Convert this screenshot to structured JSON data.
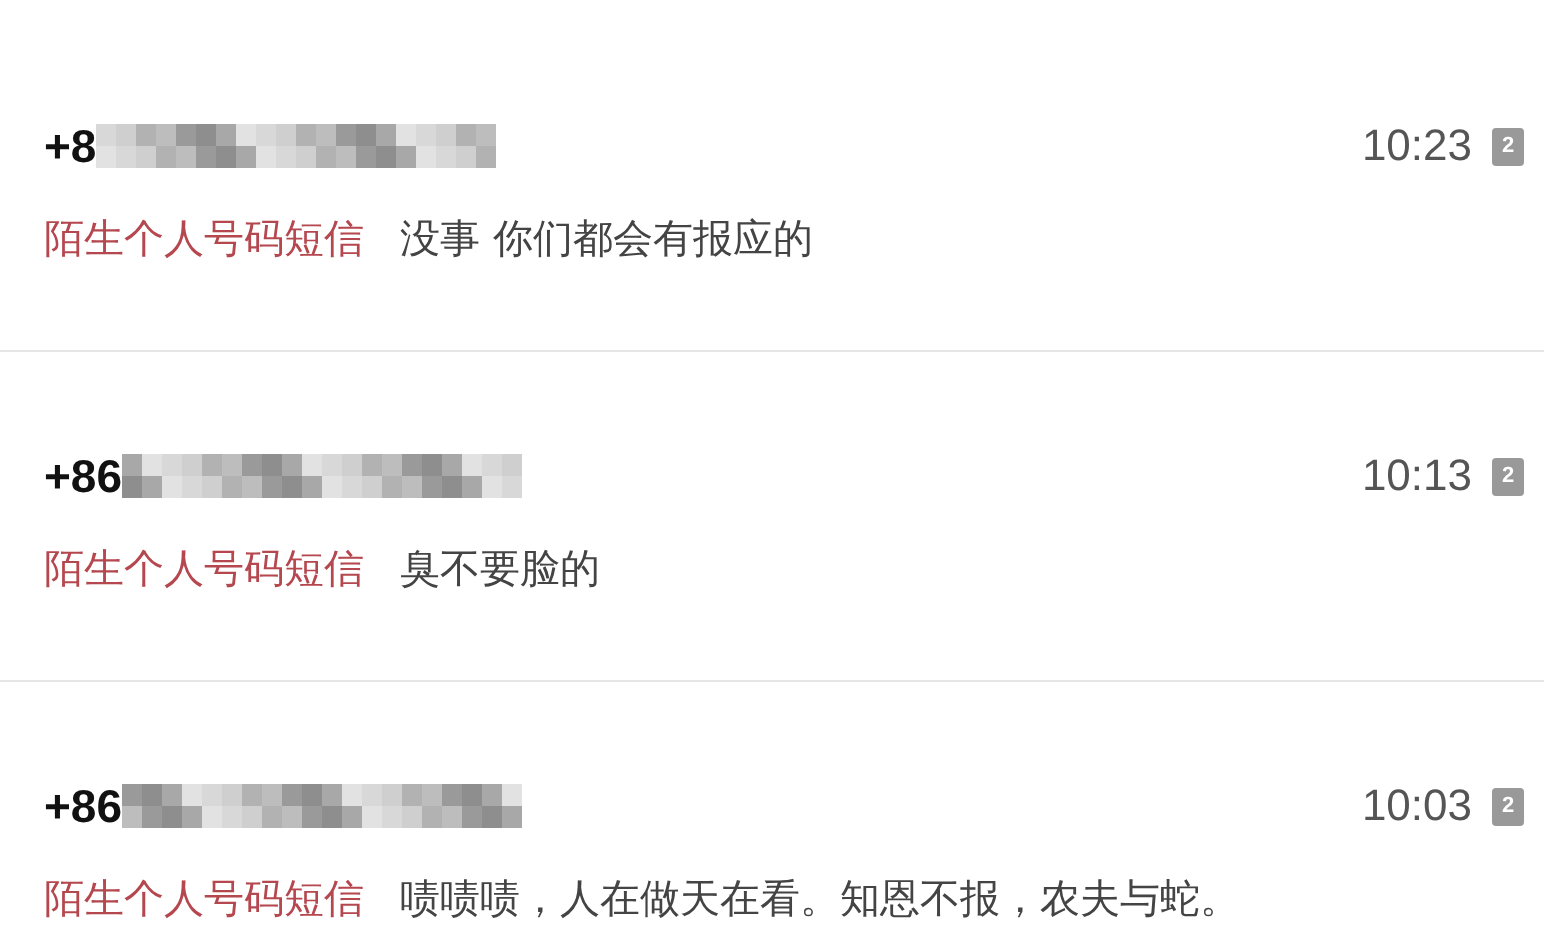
{
  "messages": [
    {
      "number": "+8",
      "time": "10:23",
      "sim": "2",
      "sender_label": "陌生个人号码短信",
      "preview": "没事 你们都会有报应的"
    },
    {
      "number": "+86",
      "time": "10:13",
      "sim": "2",
      "sender_label": "陌生个人号码短信",
      "preview": "臭不要脸的"
    },
    {
      "number": "+86",
      "time": "10:03",
      "sim": "2",
      "sender_label": "陌生个人号码短信",
      "preview": "啧啧啧，人在做天在看。知恩不报，农夫与蛇。"
    }
  ]
}
